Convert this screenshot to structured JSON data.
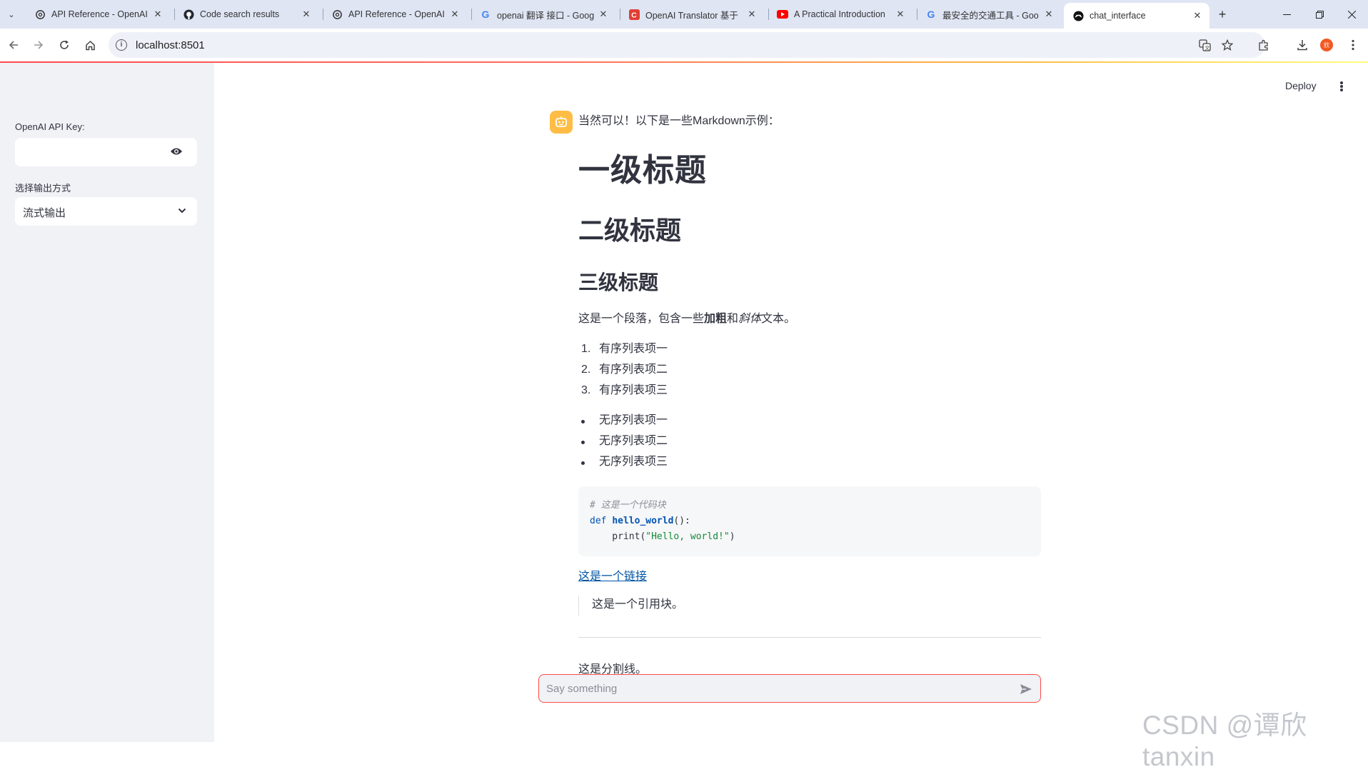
{
  "browser": {
    "tabs": [
      {
        "title": "API Reference - OpenAI",
        "icon": "openai-icon"
      },
      {
        "title": "Code search results",
        "icon": "github-icon"
      },
      {
        "title": "API Reference - OpenAI",
        "icon": "openai-icon"
      },
      {
        "title": "openai 翻译 接口 - Goog",
        "icon": "google-icon"
      },
      {
        "title": "OpenAI Translator 基于",
        "icon": "csdn-icon"
      },
      {
        "title": "A Practical Introduction",
        "icon": "youtube-icon"
      },
      {
        "title": "最安全的交通工具 - Goo",
        "icon": "google-icon"
      },
      {
        "title": "chat_interface",
        "icon": "streamlit-icon",
        "active": true
      }
    ],
    "url": "localhost:8501",
    "profile_initial": "欣"
  },
  "sidebar": {
    "api_key_label": "OpenAI API Key:",
    "api_key_value": "",
    "output_label": "选择输出方式",
    "output_selected": "流式输出"
  },
  "header": {
    "deploy_label": "Deploy"
  },
  "message": {
    "avatar_icon": "bot-icon",
    "intro": "当然可以！以下是一些Markdown示例：",
    "h1": "一级标题",
    "h2": "二级标题",
    "h3": "三级标题",
    "paragraph": {
      "before": "这是一个段落，包含一些",
      "bold": "加粗",
      "middle": "和",
      "italic": "斜体",
      "after": "文本。"
    },
    "ordered": [
      "有序列表项一",
      "有序列表项二",
      "有序列表项三"
    ],
    "unordered": [
      "无序列表项一",
      "无序列表项二",
      "无序列表项三"
    ],
    "code": {
      "comment": "# 这是一个代码块",
      "def_kw": "def",
      "fn_name": "hello_world",
      "fn_parens": "():",
      "indent_print": "    print(",
      "string": "\"Hello, world!\"",
      "close": ")"
    },
    "link": "这是一个链接",
    "quote": "这是一个引用块。",
    "after_hr": "这是分割线。"
  },
  "chat_input": {
    "placeholder": "Say something"
  },
  "watermark": "CSDN @谭欣tanxin",
  "colors": {
    "accent": "#ff4b4b",
    "sidebar_bg": "#f0f2f6",
    "avatar_bg": "#ffbd45",
    "link": "#0054a3"
  }
}
